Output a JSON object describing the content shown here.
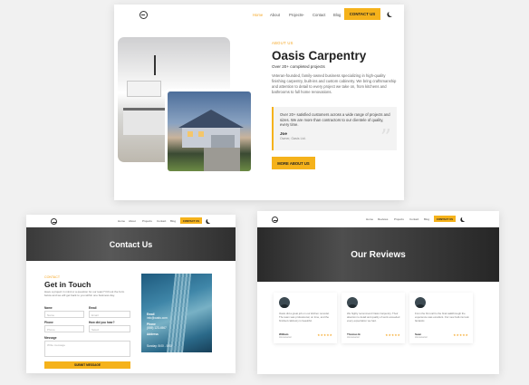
{
  "colors": {
    "accent": "#f5b21b",
    "accent_text": "#f5a623",
    "dark_hero": "#3a3a3a"
  },
  "main": {
    "nav": {
      "logo_icon": "logo-icon",
      "items": [
        "Home",
        "About",
        "Projects",
        "Contact",
        "Blog"
      ],
      "projects_chevron": "⌄",
      "cta": "CONTACT US",
      "theme_icon": "moon-icon"
    },
    "about_label": "ABOUT US",
    "title": "Oasis Carpentry",
    "subtitle": "Over 20+ completed projects",
    "body": "Veteran-founded, family-owned business specializing in high-quality finishing carpentry, built-ins and custom cabinetry. We bring craftsmanship and attention to detail to every project we take on, from kitchens and bathrooms to full home renovations.",
    "quote": {
      "text": "Over 20+ satisfied customers across a wide range of projects and sizes. We are more than contractors to our clientele of quality, every time.",
      "name": "Joe",
      "role": "Owner, Oasis Ltd.",
      "mark": "”"
    },
    "more_button": "MORE ABOUT US"
  },
  "contact": {
    "nav": {
      "items": [
        "Home",
        "About",
        "Projects",
        "Contact",
        "Blog"
      ],
      "cta": "CONTACT US"
    },
    "hero_title": "Contact Us",
    "label": "CONTACT",
    "title": "Get in Touch",
    "description": "Have a project in mind or a question for our team? Fill out the form below and we will get back to you within one business day.",
    "fields": [
      {
        "label": "Name",
        "placeholder": "Name"
      },
      {
        "label": "Email",
        "placeholder": "Email"
      },
      {
        "label": "Phone",
        "placeholder": "Phone"
      },
      {
        "label": "How did you hear?",
        "placeholder": "Select"
      },
      {
        "label": "Message",
        "placeholder": "Write message"
      }
    ],
    "submit": "SUBMIT MESSAGE",
    "info": {
      "email_label": "Email",
      "email_value": "info@oasis.com",
      "phone_label": "Phone",
      "phone_value": "(555) 123-4567",
      "address_label": "Address",
      "hours": "Sunday: 8:00 - 5:00"
    }
  },
  "reviews": {
    "nav": {
      "items": [
        "Home",
        "Reviews",
        "Projects",
        "Contact",
        "Blog"
      ],
      "cta": "CONTACT US"
    },
    "hero_title": "Our Reviews",
    "cards": [
      {
        "text": "Oasis did a great job on our kitchen remodel. The team was professional, on time, and the finished cabinetry is beautiful.",
        "name": "William",
        "role": "Homeowner",
        "stars": "★★★★★"
      },
      {
        "text": "We highly recommend Oasis Carpentry. Their attention to detail and quality of work exceeded every expectation we had.",
        "name": "Thomas B.",
        "role": "Homeowner",
        "stars": "★★★★★"
      },
      {
        "text": "From the first call to the final walkthrough the experience was excellent. Our new built-ins look fantastic.",
        "name": "Sean",
        "role": "Homeowner",
        "stars": "★★★★★"
      }
    ]
  }
}
